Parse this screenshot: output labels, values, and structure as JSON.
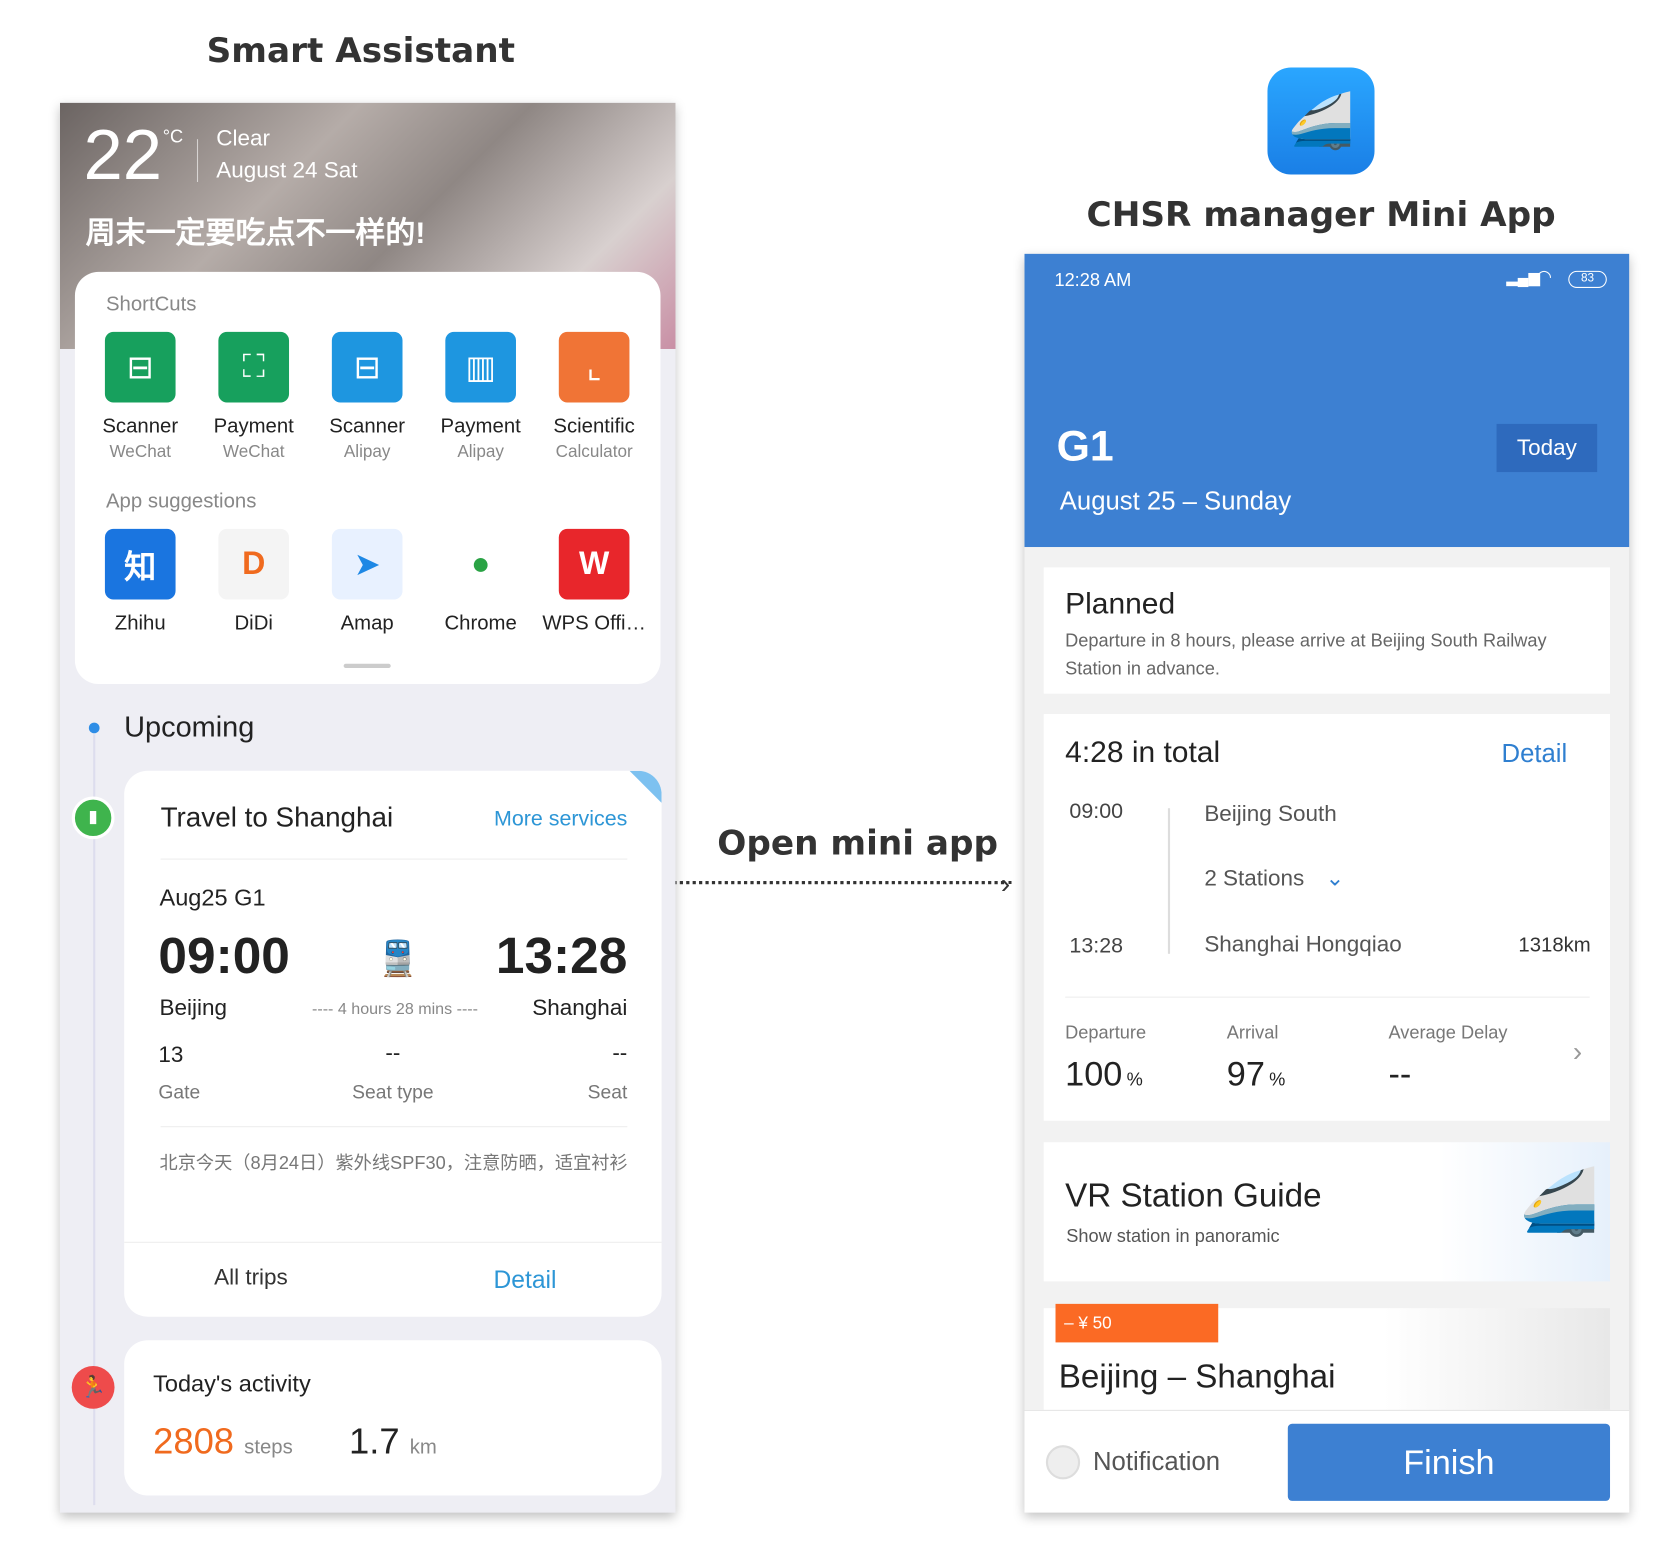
{
  "left_title": "Smart Assistant",
  "right_title": "CHSR manager Mini App",
  "arrow_label": "Open mini app",
  "assistant": {
    "temp": "22",
    "unit": "°C",
    "weather": "Clear",
    "date": "August 24 Sat",
    "slogan": "周末一定要吃点不一样的!",
    "shortcuts_title": "ShortCuts",
    "shortcuts": [
      {
        "label": "Scanner",
        "sub": "WeChat",
        "color": "#17a05d",
        "icon": "scan-icon"
      },
      {
        "label": "Payment",
        "sub": "WeChat",
        "color": "#17a05d",
        "icon": "pay-scan-icon"
      },
      {
        "label": "Scanner",
        "sub": "Alipay",
        "color": "#1e96e0",
        "icon": "scan-icon"
      },
      {
        "label": "Payment",
        "sub": "Alipay",
        "color": "#1e96e0",
        "icon": "barcode-icon"
      },
      {
        "label": "Scientific",
        "sub": "Calculator",
        "color": "#f07436",
        "icon": "graph-icon"
      }
    ],
    "apps_title": "App suggestions",
    "apps": [
      {
        "label": "Zhihu",
        "glyph": "知"
      },
      {
        "label": "DiDi",
        "glyph": "D"
      },
      {
        "label": "Amap",
        "glyph": "➤"
      },
      {
        "label": "Chrome",
        "glyph": "●"
      },
      {
        "label": "WPS Offi…",
        "glyph": "W"
      }
    ],
    "upcoming": "Upcoming",
    "travel": {
      "title": "Travel to Shanghai",
      "more": "More services",
      "train": "Aug25  G1",
      "dep_time": "09:00",
      "arr_time": "13:28",
      "dep": "Beijing",
      "arr": "Shanghai",
      "duration": "4 hours 28 mins",
      "gate": "13",
      "gate_label": "Gate",
      "seat_type": "--",
      "seat_type_label": "Seat type",
      "seat": "--",
      "seat_label": "Seat",
      "note": "北京今天（8月24日）紫外线SPF30，注意防晒，适宜衬衫",
      "all_trips": "All trips",
      "detail": "Detail"
    },
    "activity": {
      "title": "Today's activity",
      "steps": "2808",
      "steps_unit": "steps",
      "km": "1.7",
      "km_unit": "km"
    }
  },
  "mini": {
    "time": "12:28 AM",
    "battery": "83",
    "train": "G1",
    "today": "Today",
    "date": "August 25 – Sunday",
    "status": "Planned",
    "status_desc": "Departure in 8 hours, please arrive at Beijing South Railway Station in advance.",
    "total": "4:28 in total",
    "detail": "Detail",
    "dep_time": "09:00",
    "dep_station": "Beijing South",
    "stops": "2 Stations",
    "arr_time": "13:28",
    "arr_station": "Shanghai Hongqiao",
    "distance": "1318km",
    "stats": [
      {
        "label": "Departure",
        "value": "100",
        "unit": "%"
      },
      {
        "label": "Arrival",
        "value": "97",
        "unit": "%"
      },
      {
        "label": "Average Delay",
        "value": "--",
        "unit": ""
      }
    ],
    "vr_title": "VR Station Guide",
    "vr_sub": "Show station in panoramic",
    "promo_badge": "– ¥ 50",
    "promo_title": "Beijing – Shanghai",
    "notification": "Notification",
    "finish": "Finish",
    "accent": "#3d80d2"
  }
}
